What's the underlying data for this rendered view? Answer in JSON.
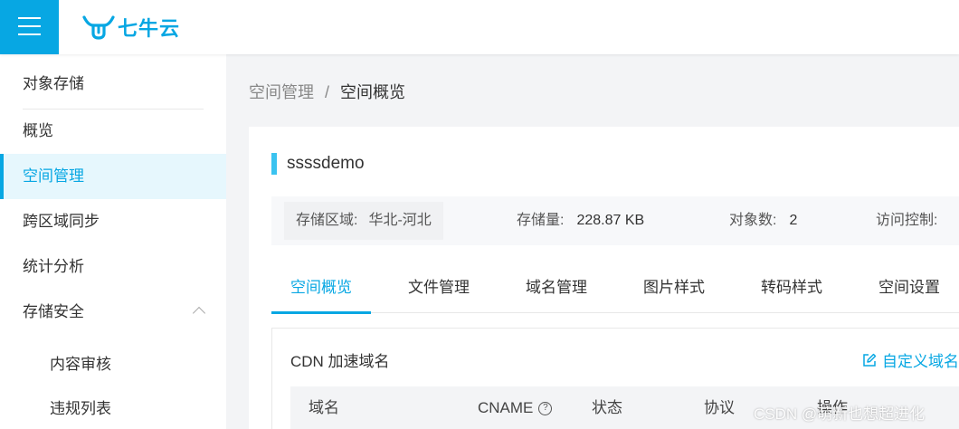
{
  "header": {
    "brand_name": "七牛云",
    "accent_color": "#07a7e3",
    "menu_icon": "hamburger-menu-icon",
    "logo_icon": "qiniu-bull-logo-icon"
  },
  "sidebar": {
    "section_title": "对象存储",
    "items": [
      {
        "label": "概览"
      },
      {
        "label": "空间管理"
      },
      {
        "label": "跨区域同步"
      },
      {
        "label": "统计分析"
      },
      {
        "label": "存储安全"
      },
      {
        "label": "内容审核"
      },
      {
        "label": "违规列表"
      }
    ],
    "active_index": 1,
    "expanded_icon": "chevron-up-icon"
  },
  "breadcrumb": {
    "parent": "空间管理",
    "separator": "/",
    "current": "空间概览"
  },
  "bucket": {
    "name": "ssssdemo",
    "region_label": "存储区域:",
    "region_value": "华北-河北",
    "size_label": "存储量:",
    "size_value": "228.87 KB",
    "objects_label": "对象数:",
    "objects_value": "2",
    "access_label": "访问控制:"
  },
  "tabs": [
    {
      "label": "空间概览"
    },
    {
      "label": "文件管理"
    },
    {
      "label": "域名管理"
    },
    {
      "label": "图片样式"
    },
    {
      "label": "转码样式"
    },
    {
      "label": "空间设置"
    }
  ],
  "active_tab": 0,
  "cdn": {
    "title": "CDN 加速域名",
    "custom_domain_link": "自定义域名",
    "edit_icon": "edit-icon",
    "columns": [
      "域名",
      "CNAME",
      "状态",
      "协议",
      "操作"
    ],
    "help_icon": "question-circle-icon"
  },
  "watermark": "CSDN @萌新也想超进化"
}
